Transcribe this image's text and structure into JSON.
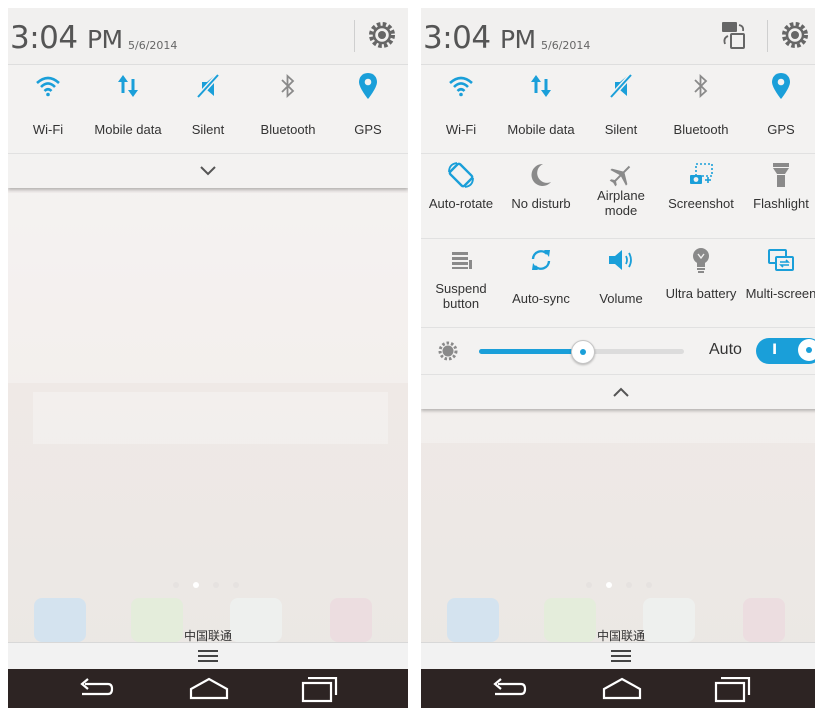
{
  "left": {
    "status": {
      "time": "3:04",
      "ampm": "PM",
      "date": "5/6/2014",
      "settings_icon": "gear-icon"
    },
    "toggles": [
      {
        "label": "Wi-Fi",
        "icon": "wifi-icon",
        "active": true
      },
      {
        "label": "Mobile data",
        "icon": "mobile-data-icon",
        "active": true
      },
      {
        "label": "Silent",
        "icon": "silent-icon",
        "active": true
      },
      {
        "label": "Bluetooth",
        "icon": "bluetooth-icon",
        "active": false
      },
      {
        "label": "GPS",
        "icon": "gps-icon",
        "active": true
      }
    ],
    "expand_icon": "chevron-down-icon",
    "carrier": "中国联通",
    "nav": [
      "back-icon",
      "home-icon",
      "recents-icon"
    ]
  },
  "right": {
    "status": {
      "time": "3:04",
      "ampm": "PM",
      "date": "5/6/2014",
      "rotate_icon": "screen-switch-icon",
      "settings_icon": "gear-icon"
    },
    "toggles_row1": [
      {
        "label": "Wi-Fi",
        "icon": "wifi-icon",
        "active": true
      },
      {
        "label": "Mobile data",
        "icon": "mobile-data-icon",
        "active": true
      },
      {
        "label": "Silent",
        "icon": "silent-icon",
        "active": true
      },
      {
        "label": "Bluetooth",
        "icon": "bluetooth-icon",
        "active": false
      },
      {
        "label": "GPS",
        "icon": "gps-icon",
        "active": true
      }
    ],
    "toggles_row2": [
      {
        "label": "Auto-rotate",
        "icon": "auto-rotate-icon",
        "active": true
      },
      {
        "label": "No disturb",
        "icon": "moon-icon",
        "active": false
      },
      {
        "label": "Airplane mode",
        "icon": "airplane-icon",
        "active": false
      },
      {
        "label": "Screenshot",
        "icon": "screenshot-icon",
        "active": true
      },
      {
        "label": "Flashlight",
        "icon": "flashlight-icon",
        "active": false
      }
    ],
    "toggles_row3": [
      {
        "label": "Suspend button",
        "icon": "suspend-button-icon",
        "active": false
      },
      {
        "label": "Auto-sync",
        "icon": "sync-icon",
        "active": true
      },
      {
        "label": "Volume",
        "icon": "volume-icon",
        "active": true
      },
      {
        "label": "Ultra battery",
        "icon": "bulb-icon",
        "active": false
      },
      {
        "label": "Multi-screen",
        "icon": "multi-screen-icon",
        "active": true
      }
    ],
    "brightness": {
      "level": 0.5,
      "auto_label": "Auto",
      "auto_on": true,
      "toggle_text": "I"
    },
    "collapse_icon": "chevron-up-icon",
    "carrier": "中国联通",
    "nav": [
      "back-icon",
      "home-icon",
      "recents-icon"
    ]
  },
  "colors": {
    "accent": "#1a9fd9",
    "inactive": "#8a8a8a",
    "navbar": "#2d2423"
  }
}
